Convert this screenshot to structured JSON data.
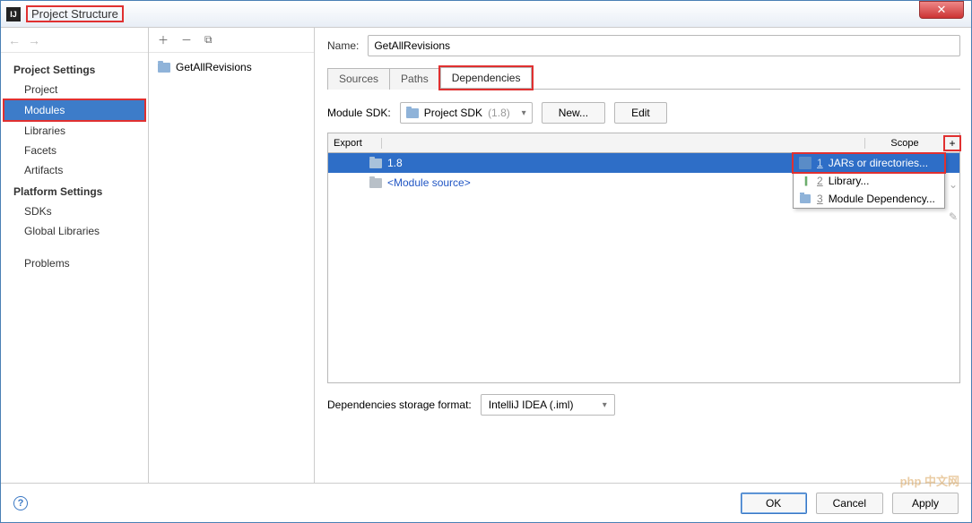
{
  "title": "Project Structure",
  "close_glyph": "✕",
  "nav": {
    "back": "←",
    "fwd": "→"
  },
  "sidebar": {
    "section1": "Project Settings",
    "items1": [
      "Project",
      "Modules",
      "Libraries",
      "Facets",
      "Artifacts"
    ],
    "section2": "Platform Settings",
    "items2": [
      "SDKs",
      "Global Libraries"
    ],
    "items3": [
      "Problems"
    ]
  },
  "tree": {
    "tools": {
      "add": "＋",
      "remove": "－",
      "copy": "⧉"
    },
    "items": [
      "GetAllRevisions"
    ]
  },
  "main": {
    "name_label": "Name:",
    "name_value": "GetAllRevisions",
    "tabs": [
      "Sources",
      "Paths",
      "Dependencies"
    ],
    "sdk_label": "Module SDK:",
    "sdk_value": "Project SDK",
    "sdk_ver": "(1.8)",
    "btn_new": "New...",
    "btn_edit": "Edit",
    "cols": {
      "export": "Export",
      "scope": "Scope",
      "add": "+"
    },
    "deps": [
      {
        "label": "1.8",
        "selected": true
      },
      {
        "label": "<Module source>",
        "link": true
      }
    ],
    "popup": [
      {
        "n": "1",
        "label": "JARs or directories...",
        "icon": "jars",
        "selected": true
      },
      {
        "n": "2",
        "label": "Library...",
        "icon": "lib"
      },
      {
        "n": "3",
        "label": "Module Dependency...",
        "icon": "mod"
      }
    ],
    "side": {
      "chev": "⌄",
      "pen": "✎"
    },
    "storage_label": "Dependencies storage format:",
    "storage_value": "IntelliJ IDEA (.iml)"
  },
  "footer": {
    "help": "?",
    "ok": "OK",
    "cancel": "Cancel",
    "apply": "Apply"
  },
  "watermark": "php 中文网"
}
